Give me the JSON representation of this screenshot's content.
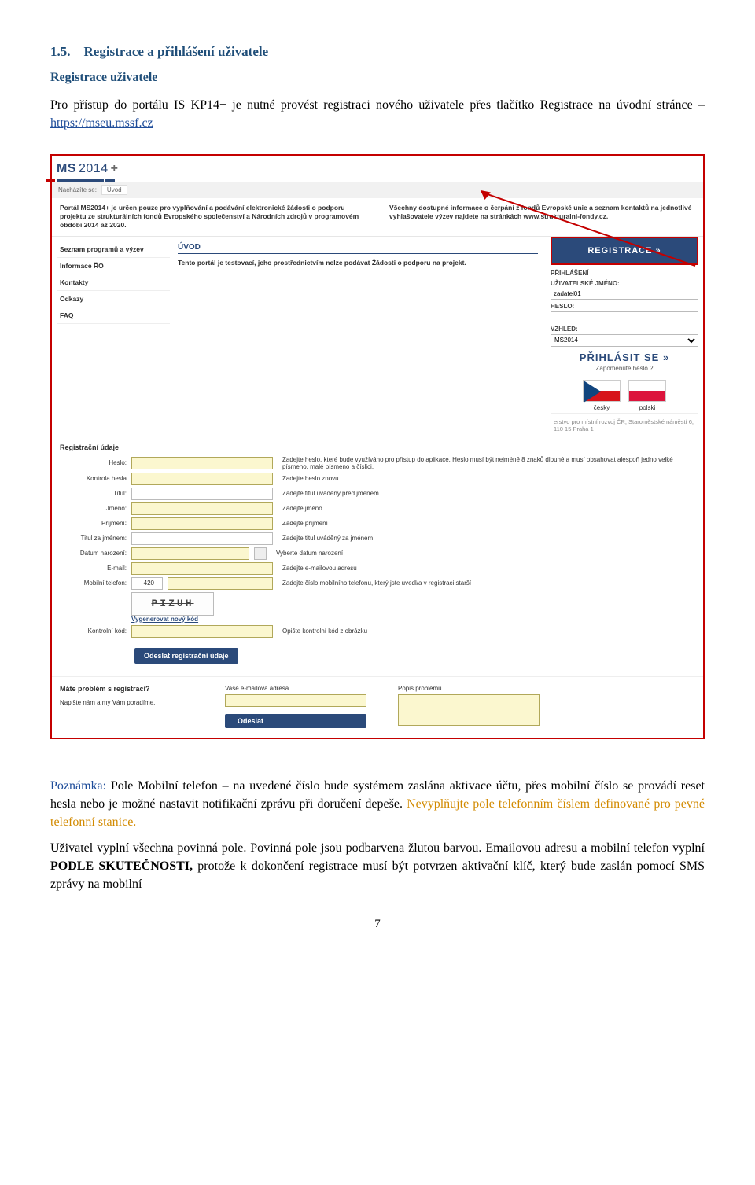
{
  "doc": {
    "heading": "1.5. Registrace a přihlášení uživatele",
    "subhead": "Registrace uživatele",
    "p1a": "Pro přístup do portálu IS KP14+ je nutné provést registraci nového uživatele přes tlačítko Registrace na úvodní stránce – ",
    "p1link": "https://mseu.mssf.cz",
    "p2lead": "Poznámka:",
    "p2a": " Pole Mobilní telefon – na uvedené číslo bude systémem zaslána aktivace účtu, přes mobilní číslo se provádí reset hesla nebo je možné nastavit notifikační zprávu při doručení depeše. ",
    "p2orange": "Nevyplňujte pole telefonním číslem definované pro pevné telefonní stanice.",
    "p3a": "Uživatel vyplní všechna povinná pole. Povinná pole jsou podbarvena žlutou barvou. Emailovou adresu a mobilní telefon vyplní ",
    "p3b": "PODLE SKUTEČNOSTI,",
    "p3c": " protože k dokončení registrace musí být potvrzen aktivační klíč, který bude zaslán pomocí SMS zprávy na mobilní",
    "pagenum": "7"
  },
  "shot": {
    "logo1": "MS",
    "logo2": "2014",
    "logo3": "+",
    "bc_label": "Nacházíte se:",
    "bc_val": "Úvod",
    "intro_left": "Portál MS2014+ je určen pouze pro vyplňování a podávání elektronické žádosti o podporu projektu ze strukturálních fondů Evropského společenství a Národních zdrojů v programovém období 2014 až 2020.",
    "intro_right": "Všechny dostupné informace o čerpání z fondů Evropské unie a seznam kontaktů na jednotlivé vyhlašovatele výzev najdete na stránkách www.strukturalni-fondy.cz.",
    "sidemenu": [
      "Seznam programů a výzev",
      "Informace ŘO",
      "Kontakty",
      "Odkazy",
      "FAQ"
    ],
    "uvod_head": "ÚVOD",
    "mid_text": "Tento portál je testovací, jeho prostřednictvím nelze podávat Žádosti o podporu na projekt.",
    "reg_btn": "REGISTRACE »",
    "login_head": "PŘIHLÁŠENÍ",
    "login_user_label": "UŽIVATELSKÉ JMÉNO:",
    "login_user_val": "zadatel01",
    "login_pass_label": "HESLO:",
    "skin_label": "VZHLED:",
    "skin_val": "MS2014",
    "login_btn": "PŘIHLÁSIT SE »",
    "forgot": "Zapomenuté heslo ?",
    "flag_cz": "česky",
    "flag_pl": "polski",
    "footer_right": "erstvo pro místní rozvoj ČR, Staroměstské náměstí 6, 110 15 Praha 1",
    "form_title": "Registrační údaje",
    "rows": [
      {
        "label": "Heslo:",
        "help": "Zadejte heslo, které bude využíváno pro přístup do aplikace. Heslo musí být nejméně 8 znaků dlouhé a musí obsahovat alespoň jedno velké písmeno, malé písmeno a číslici."
      },
      {
        "label": "Kontrola hesla",
        "help": "Zadejte heslo znovu"
      },
      {
        "label": "Titul:",
        "help": "Zadejte titul uváděný před jménem"
      },
      {
        "label": "Jméno:",
        "help": "Zadejte jméno"
      },
      {
        "label": "Příjmení:",
        "help": "Zadejte příjmení"
      },
      {
        "label": "Titul za jménem:",
        "help": "Zadejte titul uváděný za jménem"
      },
      {
        "label": "Datum narození:",
        "help": "Vyberte datum narození"
      },
      {
        "label": "E-mail:",
        "help": "Zadejte e-mailovou adresu"
      },
      {
        "label": "Mobilní telefon:",
        "help": "Zadejte číslo mobilního telefonu, který jste uvedl/a v registraci starší"
      }
    ],
    "phone_prefix": "+420",
    "captcha_text": "PIZUH",
    "gen_link": "Vygenerovat nový kód",
    "kk_label": "Kontrolní kód:",
    "kk_help": "Opište kontrolní kód z obrázku",
    "submit": "Odeslat registrační údaje",
    "prob_q": "Máte problém s registrací?",
    "prob_a": "Napište nám a my Vám poradíme.",
    "prob_email": "Vaše e-mailová adresa",
    "prob_desc": "Popis problému",
    "send": "Odeslat"
  }
}
